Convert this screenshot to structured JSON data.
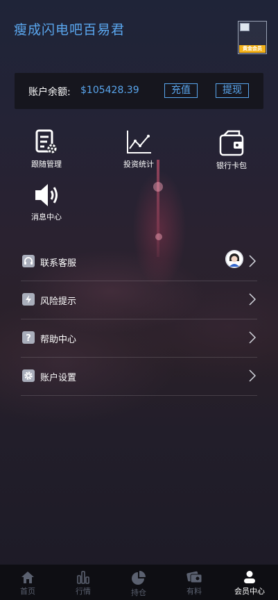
{
  "header": {
    "title": "瘦成闪电吧百易君",
    "vip_badge": "黄金会员"
  },
  "balance": {
    "label": "账户余额:",
    "value": "$105428.39",
    "recharge_label": "充值",
    "withdraw_label": "提现"
  },
  "grid": [
    {
      "label": "跟随管理",
      "icon": "document-gear-icon"
    },
    {
      "label": "投资统计",
      "icon": "line-chart-icon"
    },
    {
      "label": "银行卡包",
      "icon": "wallet-icon"
    },
    {
      "label": "消息中心",
      "icon": "speaker-icon"
    }
  ],
  "menu": [
    {
      "label": "联系客服",
      "icon": "headset-icon"
    },
    {
      "label": "风险提示",
      "icon": "lightning-icon"
    },
    {
      "label": "帮助中心",
      "icon": "question-icon"
    },
    {
      "label": "账户设置",
      "icon": "gear-icon"
    }
  ],
  "tabs": [
    {
      "label": "首页",
      "icon": "home-icon"
    },
    {
      "label": "行情",
      "icon": "bars-icon"
    },
    {
      "label": "持仓",
      "icon": "pie-icon"
    },
    {
      "label": "有料",
      "icon": "cards-icon"
    },
    {
      "label": "会员中心",
      "icon": "user-icon",
      "active": true
    }
  ],
  "colors": {
    "accent": "#5aa7ef",
    "badge": "#f4b21a",
    "tabbar": "#0e0e13",
    "tab_inactive": "#5b6170"
  }
}
